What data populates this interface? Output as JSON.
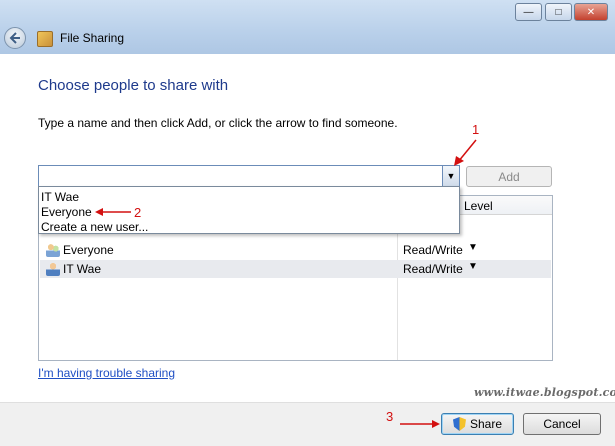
{
  "window": {
    "title": "File Sharing",
    "controls": {
      "minimize": "—",
      "maximize": "□",
      "close": "✕"
    }
  },
  "main": {
    "heading": "Choose people to share with",
    "instruction": "Type a name and then click Add, or click the arrow to find someone.",
    "name_input": {
      "value": "",
      "placeholder": ""
    },
    "add_label": "Add",
    "dropdown": {
      "items": [
        "IT Wae",
        "Everyone",
        "Create a new user..."
      ]
    },
    "list": {
      "level_header": "Level",
      "rows": [
        {
          "name": "Everyone",
          "level": "Read/Write",
          "icon": "users-group-icon"
        },
        {
          "name": "IT Wae",
          "level": "Read/Write",
          "icon": "user-icon",
          "selected": true
        }
      ]
    },
    "trouble_link": "I'm having trouble sharing"
  },
  "annotations": {
    "step1": "1",
    "step2": "2",
    "step3": "3"
  },
  "watermark": "www.itwae.blogspot.com",
  "footer": {
    "share_label": "Share",
    "cancel_label": "Cancel"
  },
  "colors": {
    "heading": "#1e3a8c",
    "link": "#1f4fc4",
    "annotation": "#d31010",
    "selected_row": "#e8eaee"
  }
}
